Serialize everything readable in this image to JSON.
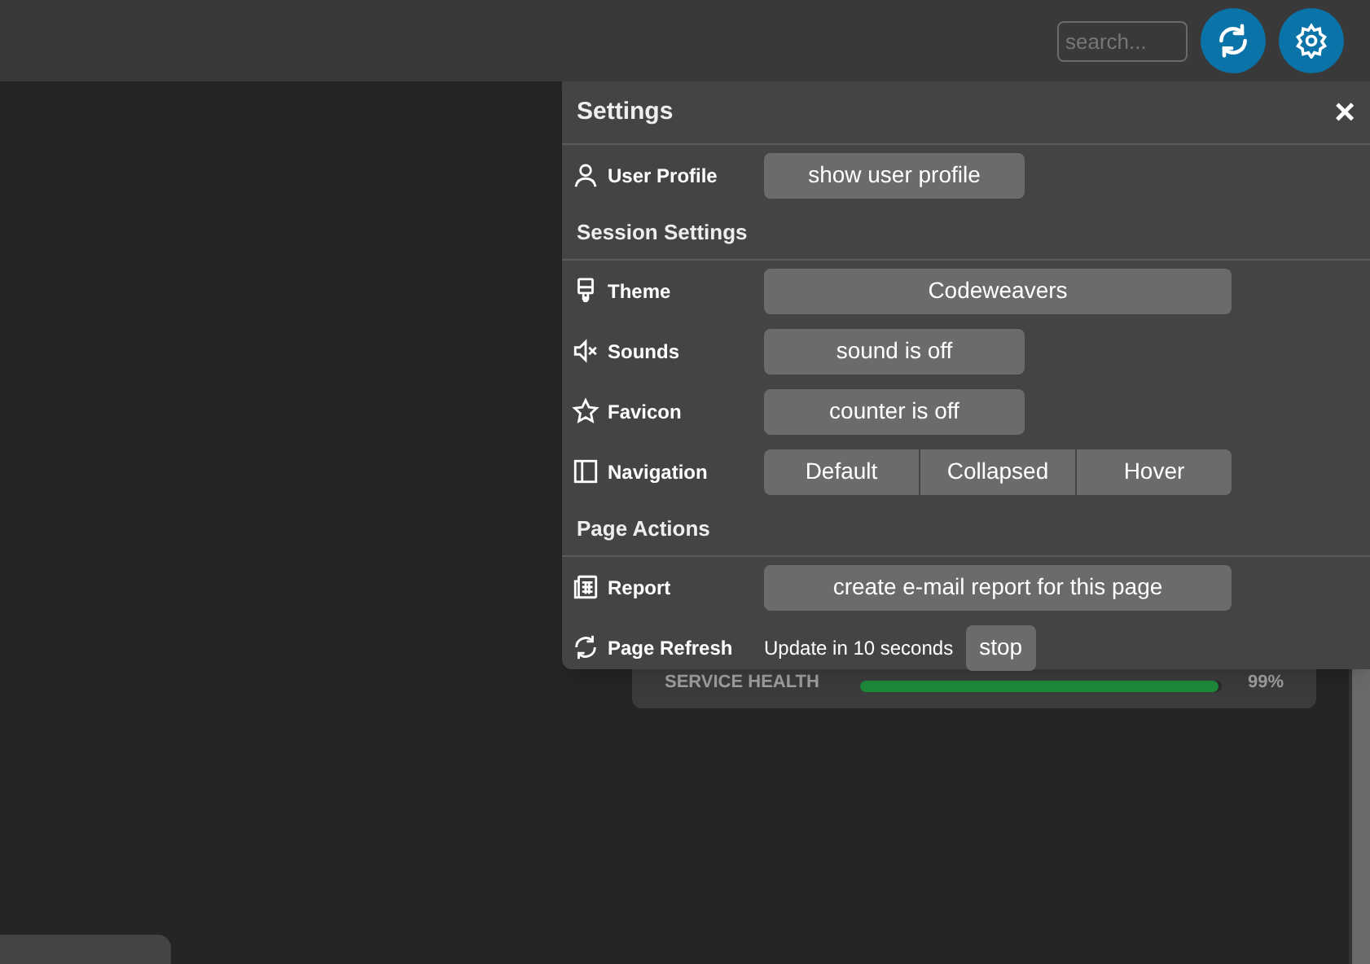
{
  "topbar": {
    "search": {
      "placeholder": "search..."
    }
  },
  "health": {
    "label": "SERVICE HEALTH",
    "level": 0.99,
    "reading": "99%"
  },
  "settings": {
    "title": "Settings",
    "close": "×",
    "rows": [
      {
        "kind": "button",
        "label": "User Profile",
        "button": "show user profile"
      },
      {
        "kind": "heading",
        "label": "Session Settings"
      },
      {
        "kind": "wide",
        "label": "Theme",
        "button": "Codeweavers"
      },
      {
        "kind": "button",
        "label": "Sounds",
        "button": "sound is off"
      },
      {
        "kind": "button",
        "label": "Favicon",
        "button": "counter is off"
      },
      {
        "kind": "segments",
        "label": "Navigation",
        "options": [
          "Default",
          "Collapsed",
          "Hover"
        ]
      },
      {
        "kind": "heading",
        "label": "Page Actions"
      },
      {
        "kind": "wide",
        "label": "Report",
        "button": "create e-mail report for this page"
      },
      {
        "kind": "refresh",
        "label": "Page Refresh",
        "text": "Update in 10 seconds",
        "button": "stop"
      }
    ]
  }
}
